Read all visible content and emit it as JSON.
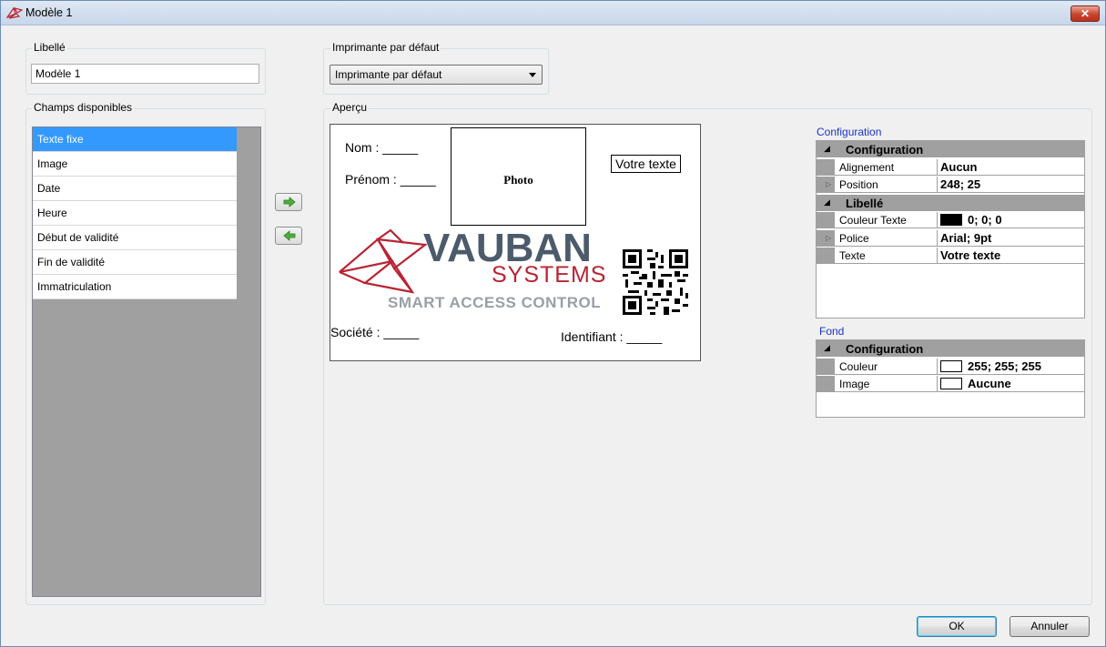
{
  "window": {
    "title": "Modèle 1",
    "close_label": "✕"
  },
  "libelle": {
    "group_label": "Libellé",
    "value": "Modèle 1"
  },
  "printer": {
    "group_label": "Imprimante par défaut",
    "selected": "Imprimante par défaut"
  },
  "fields": {
    "group_label": "Champs disponibles",
    "items": [
      "Texte fixe",
      "Image",
      "Date",
      "Heure",
      "Début de validité",
      "Fin de validité",
      "Immatriculation"
    ],
    "selected_index": 0
  },
  "transfer": {
    "add_icon": "arrow-right-icon",
    "remove_icon": "arrow-left-icon"
  },
  "preview": {
    "group_label": "Aperçu",
    "nom": "Nom : _____",
    "prenom": "Prénom : _____",
    "photo": "Photo",
    "votre_texte": "Votre texte",
    "logo_main": "VAUBAN",
    "logo_sub": "SYSTEMS",
    "logo_tagline": "SMART ACCESS CONTROL",
    "societe": "Société : _____",
    "identifiant": "Identifiant : _____"
  },
  "configuration": {
    "section_label": "Configuration",
    "categories": [
      {
        "name": "Configuration",
        "props": [
          {
            "name": "Alignement",
            "value": "Aucun"
          },
          {
            "name": "Position",
            "value": "248; 25"
          }
        ]
      },
      {
        "name": "Libellé",
        "props": [
          {
            "name": "Couleur Texte",
            "value": "0; 0; 0",
            "swatch": "#000000"
          },
          {
            "name": "Police",
            "value": "Arial; 9pt"
          },
          {
            "name": "Texte",
            "value": "Votre texte"
          }
        ]
      }
    ]
  },
  "fond": {
    "section_label": "Fond",
    "categories": [
      {
        "name": "Configuration",
        "props": [
          {
            "name": "Couleur",
            "value": "255; 255; 255",
            "swatch": "#ffffff"
          },
          {
            "name": "Image",
            "value": "Aucune",
            "swatch": "#ffffff"
          }
        ]
      }
    ]
  },
  "buttons": {
    "ok": "OK",
    "cancel": "Annuler"
  },
  "colors": {
    "selection": "#3399ff",
    "section_label": "#1a33c4",
    "logo_red": "#b92433",
    "logo_gray": "#4c5b6b"
  }
}
